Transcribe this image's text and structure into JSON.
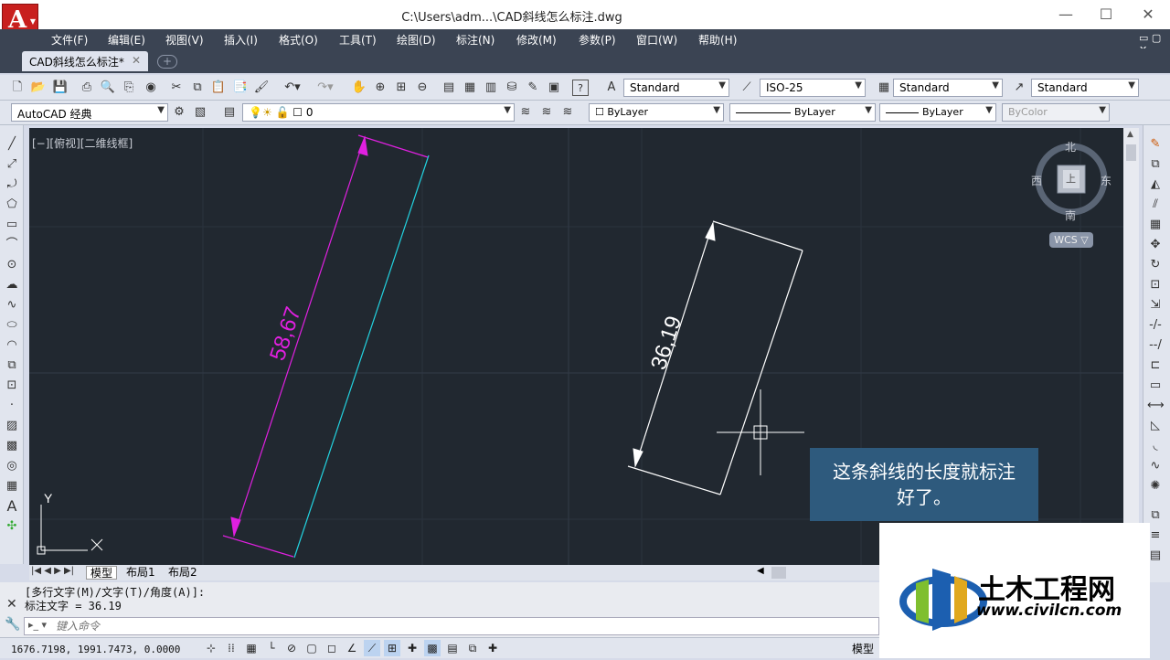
{
  "window": {
    "title": "C:\\Users\\adm...\\CAD斜线怎么标注.dwg",
    "minimize": "—",
    "maximize": "☐",
    "close": "✕"
  },
  "menu": [
    "文件(F)",
    "编辑(E)",
    "视图(V)",
    "插入(I)",
    "格式(O)",
    "工具(T)",
    "绘图(D)",
    "标注(N)",
    "修改(M)",
    "参数(P)",
    "窗口(W)",
    "帮助(H)"
  ],
  "tab": {
    "label": "CAD斜线怎么标注*",
    "close": "✕",
    "new": "+"
  },
  "toolbar": {
    "text_style": "Standard",
    "dim_style": "ISO-25",
    "table_style": "Standard",
    "multileader_style": "Standard",
    "workspace": "AutoCAD 经典",
    "layer": "0",
    "color": "ByLayer",
    "linetype": "ByLayer",
    "lineweight": "ByLayer",
    "plotstyle": "ByColor"
  },
  "viewport": {
    "label": "[−][俯视][二维线框]",
    "compass": {
      "north": "北",
      "south": "南",
      "east": "东",
      "west": "西",
      "center": "上"
    },
    "wcs": "WCS ▽",
    "ucs_y": "Y"
  },
  "dimensions": {
    "dim1": "58,67",
    "dim2": "36,19"
  },
  "colors": {
    "dim1": "#e020e0",
    "line1": "#22d3e0",
    "dim2": "#ffffff",
    "background": "#212830",
    "tip": "#2e5a7d"
  },
  "tooltip": {
    "line1": "这条斜线的长度就标注",
    "line2": "好了。"
  },
  "layout_tabs": [
    "模型",
    "布局1",
    "布局2"
  ],
  "command": {
    "log1": "[多行文字(M)/文字(T)/角度(A)]:",
    "log2": "标注文字 = 36.19",
    "placeholder": "键入命令"
  },
  "status": {
    "coords": "1676.7198, 1991.7473, 0.0000",
    "model": "模型"
  },
  "watermark": {
    "title": "土木工程网",
    "url": "www.civilcn.com"
  }
}
